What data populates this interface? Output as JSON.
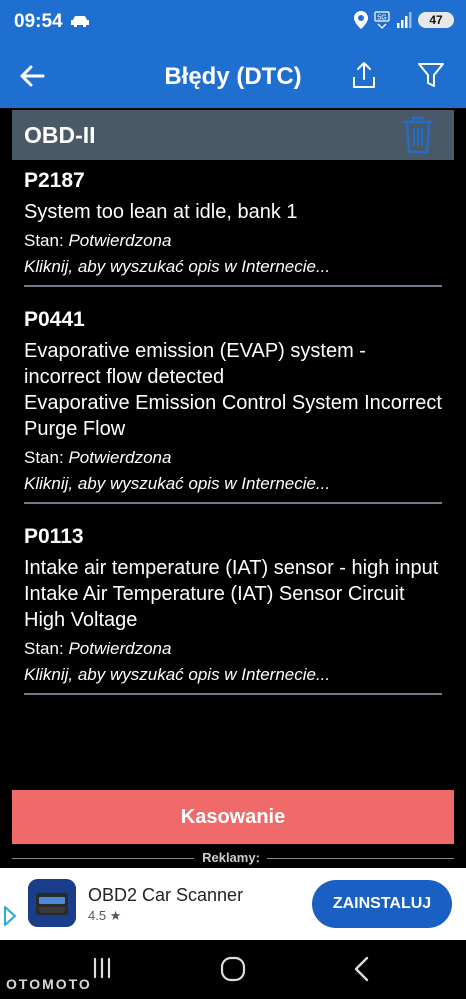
{
  "status_bar": {
    "time": "09:54",
    "battery": "47",
    "icons": [
      "car-icon",
      "location-icon",
      "5g-icon",
      "signal-icon",
      "battery-icon"
    ]
  },
  "app_bar": {
    "title": "Błędy (DTC)",
    "icons": [
      "back-arrow-icon",
      "share-icon",
      "filter-icon"
    ]
  },
  "section": {
    "title": "OBD-II",
    "icon": "trash-icon"
  },
  "dtc_items": [
    {
      "code": "P2187",
      "description": "System too lean at idle, bank 1",
      "status_label": "Stan:",
      "status_value": "Potwierdzona",
      "search_text": "Kliknij, aby wyszukać opis w Internecie..."
    },
    {
      "code": "P0441",
      "description": "Evaporative emission (EVAP) system - incorrect flow detected\nEvaporative Emission Control System Incorrect Purge Flow",
      "status_label": "Stan:",
      "status_value": "Potwierdzona",
      "search_text": "Kliknij, aby wyszukać opis w Internecie..."
    },
    {
      "code": "P0113",
      "description": "Intake air temperature (IAT) sensor - high input\nIntake Air Temperature (IAT) Sensor Circuit High Voltage",
      "status_label": "Stan:",
      "status_value": "Potwierdzona",
      "search_text": "Kliknij, aby wyszukać opis w Internecie..."
    }
  ],
  "clear_button": {
    "label": "Kasowanie"
  },
  "ads": {
    "label": "Reklamy:",
    "app_name": "OBD2 Car Scanner",
    "rating": "4.5",
    "install_label": "ZAINSTALUJ"
  },
  "watermark": "OTOMOTO",
  "colors": {
    "app_bar": "#1f6fd1",
    "section_header": "#4a5968",
    "clear_button": "#f06a6a",
    "install_button": "#1a5fc4",
    "trash_icon": "#1f6fd1"
  }
}
